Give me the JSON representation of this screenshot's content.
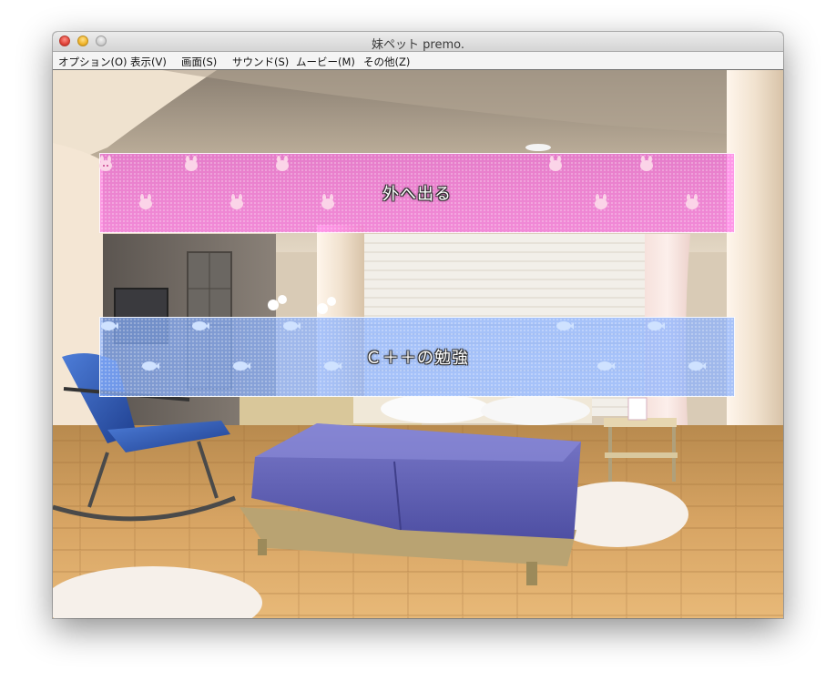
{
  "window": {
    "title": "妹ペット premo."
  },
  "menu": [
    {
      "label": "オプション(O)"
    },
    {
      "label": "表示(V)"
    },
    {
      "label": "画面(S)"
    },
    {
      "label": "サウンド(S)"
    },
    {
      "label": "ムービー(M)"
    },
    {
      "label": "その他(Z)"
    }
  ],
  "choices": [
    {
      "label": "外へ出る",
      "color": "#ff60e8",
      "motif": "bunny-icon"
    },
    {
      "label": "Ｃ＋＋の勉強",
      "color": "#88b0ff",
      "motif": "fish-icon"
    }
  ],
  "scene": {
    "setting": "bedroom"
  }
}
